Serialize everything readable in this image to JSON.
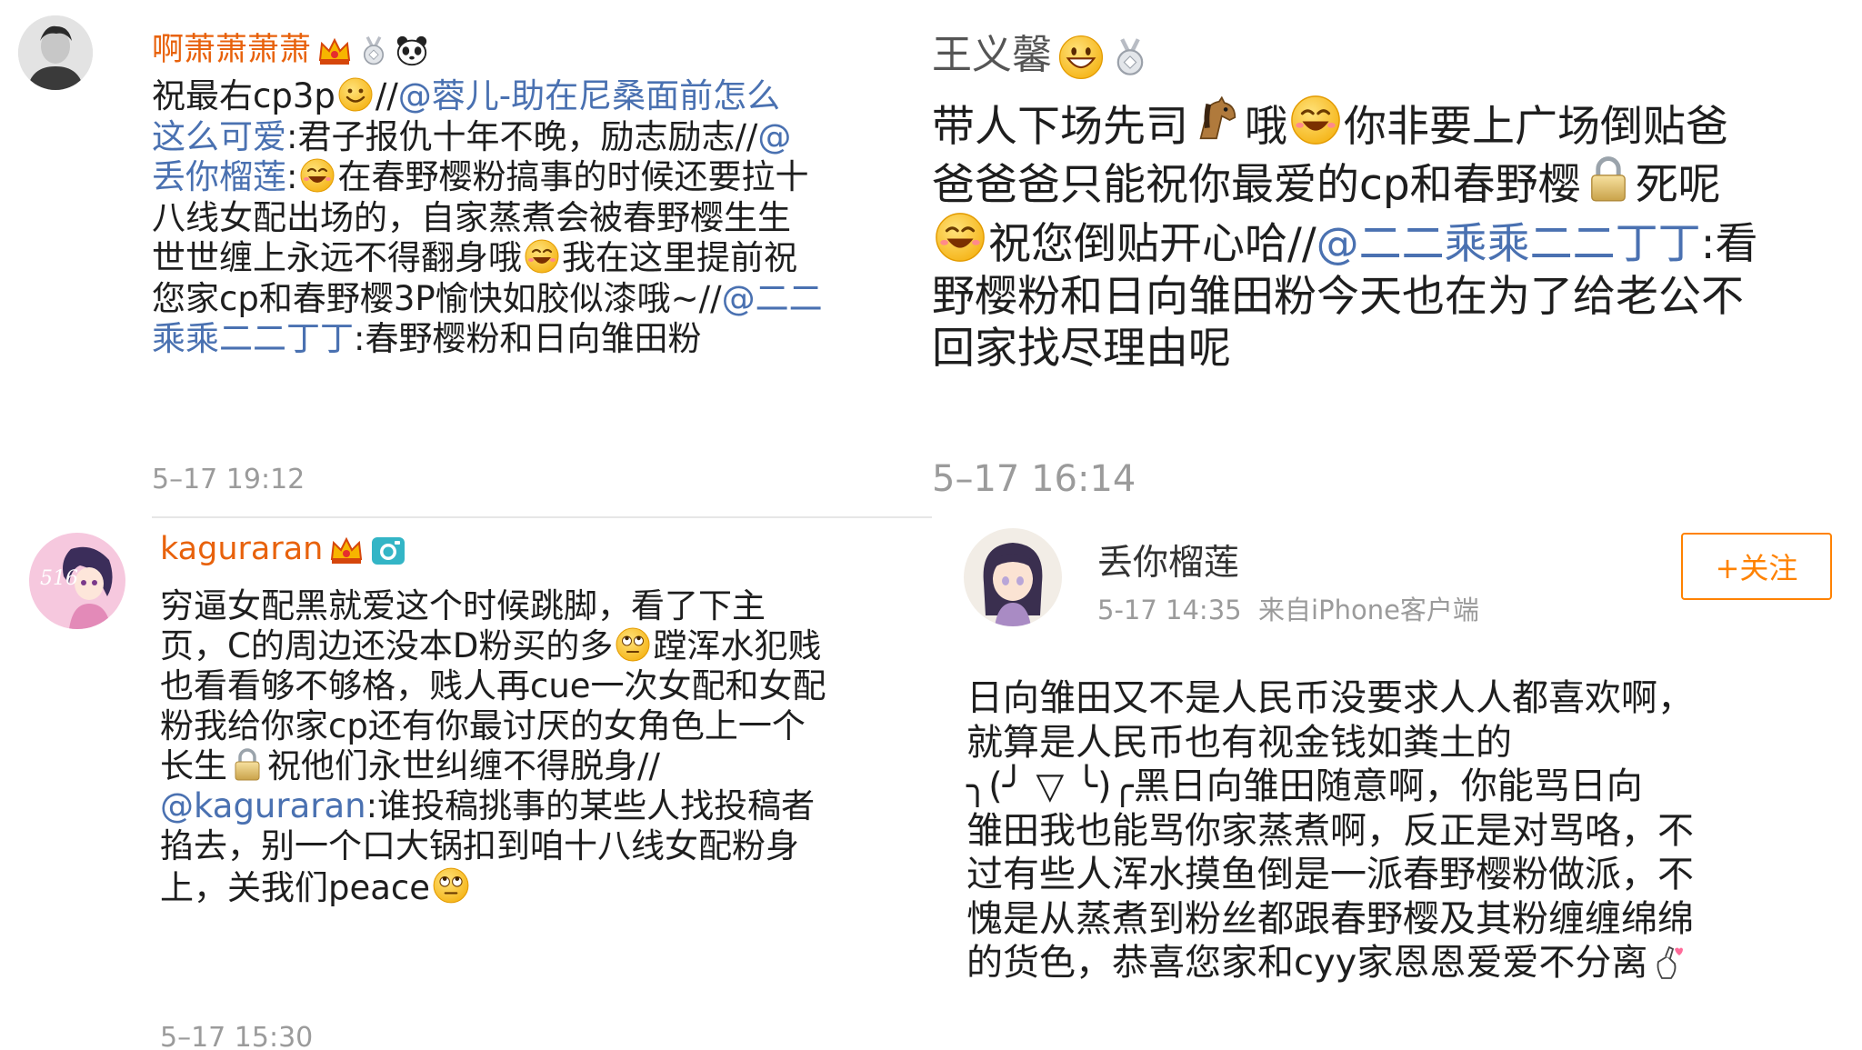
{
  "post_tl": {
    "username": "啊萧萧萧萧",
    "body": {
      "l1a": "祝最右cp3p",
      "l1b": "//",
      "l1c": "@蓉儿-助在尼桑面前怎么",
      "l2a": "这么可爱",
      "l2b": ":君子报仇十年不晚，励志励志//",
      "l2c": "@",
      "l3a": "丢你榴莲",
      "l3b": ":",
      "l3c": "在春野樱粉搞事的时候还要拉十",
      "l4": "八线女配出场的，自家蒸煮会被春野樱生生",
      "l5a": "世世缠上永远不得翻身哦",
      "l5b": "我在这里提前祝",
      "l6a": "您家cp和春野樱3P愉快如胶似漆哦~//",
      "l6b": "@二二",
      "l7a": "乘乘二二丁丁",
      "l7b": ":春野樱粉和日向雏田粉"
    },
    "time": "5–17 19:12"
  },
  "post_bl": {
    "username": "kaguraran",
    "avatar_text": "516",
    "body": {
      "l1": "穷逼女配黑就爱这个时候跳脚，看了下主",
      "l2a": "页，C的周边还没本D粉买的多",
      "l2b": "蹚浑水犯贱",
      "l3": "也看看够不够格，贱人再cue一次女配和女配",
      "l4": "粉我给你家cp还有你最讨厌的女角色上一个",
      "l5a": "长生",
      "l5b": "祝他们永世纠缠不得脱身//",
      "l6a": "@kaguraran",
      "l6b": ":谁投稿挑事的某些人找投稿者",
      "l7": "掐去，别一个口大锅扣到咱十八线女配粉身",
      "l8": "上，关我们peace"
    },
    "time": "5–17 15:30"
  },
  "post_tr": {
    "username": "王义馨",
    "body": {
      "l1a": "带人下场先司",
      "l1b": "哦",
      "l1c": "你非要上广场倒贴爸",
      "l2a": "爸爸爸只能祝你最爱的cp和春野樱",
      "l2b": "死呢",
      "l3a": "祝您倒贴开心哈//",
      "l3b": "@二二乘乘二二丁丁",
      "l3c": ":看",
      "l4": "野樱粉和日向雏田粉今天也在为了给老公不",
      "l5": "回家找尽理由呢"
    },
    "time": "5–17 16:14"
  },
  "post_br": {
    "username": "丢你榴莲",
    "meta": "5-17 14:35  来自iPhone客户端",
    "follow_label": "+关注",
    "body": {
      "l1": "日向雏田又不是人民币没要求人人都喜欢啊，",
      "l2": "就算是人民币也有视金钱如粪土的",
      "l3": "╮(╯ ▽ ╰)╭黑日向雏田随意啊，你能骂日向",
      "l4": "雏田我也能骂你家蒸煮啊，反正是对骂咯，不",
      "l5": "过有些人浑水摸鱼倒是一派春野樱粉做派，不",
      "l6": "愧是从蒸煮到粉丝都跟春野樱及其粉缠缠绵绵",
      "l7": "的货色，恭喜您家和cyy家恩恩爱爱不分离"
    }
  },
  "colors": {
    "username_orange": "#e8620c",
    "mention_blue": "#4a71b1",
    "time_gray": "#9b9b9b",
    "follow_orange": "#ff8200"
  },
  "icons": [
    "vip-crown-icon",
    "medal-icon",
    "panda-icon",
    "camera-icon",
    "smiley-emoji-icon",
    "laugh-emoji-icon",
    "grin-emoji-icon",
    "eyeroll-emoji-icon",
    "horse-emoji-icon",
    "lock-emoji-icon",
    "finger-heart-icon"
  ]
}
